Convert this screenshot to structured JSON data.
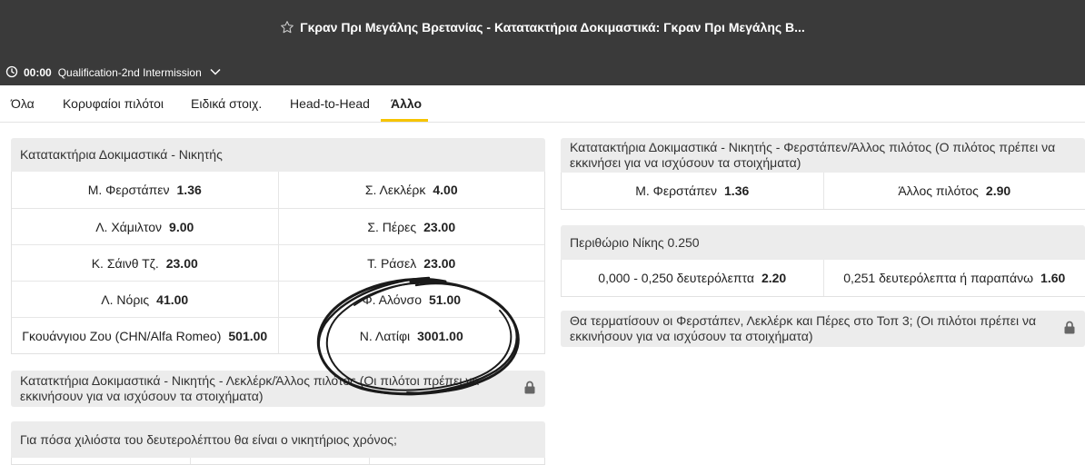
{
  "header": {
    "title": "Γκραν Πρι Μεγάλης Βρετανίας - Κατατακτήρια Δοκιμαστικά: Γκραν Πρι Μεγάλης Β...",
    "time": "00:00",
    "status": "Qualification-2nd Intermission"
  },
  "tabs": [
    {
      "label": "Όλα"
    },
    {
      "label": "Κορυφαίοι πιλότοι"
    },
    {
      "label": "Ειδικά στοιχ."
    },
    {
      "label": "Head-to-Head"
    },
    {
      "label": "Άλλο"
    }
  ],
  "markets": {
    "winner": {
      "title": "Κατατακτήρια Δοκιμαστικά - Νικητής",
      "rows": [
        [
          {
            "name": "Μ. Φερστάπεν",
            "odd": "1.36"
          },
          {
            "name": "Σ. Λεκλέρκ",
            "odd": "4.00"
          }
        ],
        [
          {
            "name": "Λ. Χάμιλτον",
            "odd": "9.00"
          },
          {
            "name": "Σ. Πέρες",
            "odd": "23.00"
          }
        ],
        [
          {
            "name": "Κ. Σάινθ Τζ.",
            "odd": "23.00"
          },
          {
            "name": "Τ. Ράσελ",
            "odd": "23.00"
          }
        ],
        [
          {
            "name": "Λ. Νόρις",
            "odd": "41.00"
          },
          {
            "name": "Φ. Αλόνσο",
            "odd": "51.00"
          }
        ],
        [
          {
            "name": "Γκουάνγιου Ζου (CHN/Alfa Romeo)",
            "odd": "501.00"
          },
          {
            "name": "Ν. Λατίφι",
            "odd": "3001.00"
          }
        ]
      ]
    },
    "leclerc_other": {
      "title": "Κατατκτήρια Δοκιμαστικά - Νικητής - Λεκλέρκ/Άλλος πιλότος (Οι πιλότοι πρέπει να εκκινήσουν για να ισχύσουν τα στοιχήματα)"
    },
    "thousandths": {
      "title": "Για πόσα χιλιόστα του δευτερολέπτου θα είναι ο νικητήριος χρόνος;"
    },
    "verstappen_other": {
      "title": "Κατατακτήρια Δοκιμαστικά - Νικητής - Φερστάπεν/Άλλος πιλότος (Ο πιλότος πρέπει να εκκινήσει για να ισχύσουν τα στοιχήματα)",
      "rows": [
        [
          {
            "name": "Μ. Φερστάπεν",
            "odd": "1.36"
          },
          {
            "name": "Άλλος πιλότος",
            "odd": "2.90"
          }
        ]
      ]
    },
    "margin": {
      "title": "Περιθώριο Νίκης 0.250",
      "rows": [
        [
          {
            "name": "0,000 - 0,250 δευτερόλεπτα",
            "odd": "2.20"
          },
          {
            "name": "0,251 δευτερόλεπτα ή παραπάνω",
            "odd": "1.60"
          }
        ]
      ]
    },
    "top3": {
      "title": "Θα τερματίσουν οι Φερστάπεν, Λεκλέρκ και Πέρες στο Τοπ 3; (Οι πιλότοι πρέπει να εκκινήσουν για να ισχύσουν τα στοιχήματα)"
    }
  },
  "icons": {
    "star": "star-outline-icon",
    "clock": "clock-icon",
    "chevron": "chevron-down-icon",
    "lock": "lock-icon"
  },
  "colors": {
    "header_bg": "#3a3a3a",
    "accent": "#f6c400",
    "panel_head": "#ececec"
  }
}
